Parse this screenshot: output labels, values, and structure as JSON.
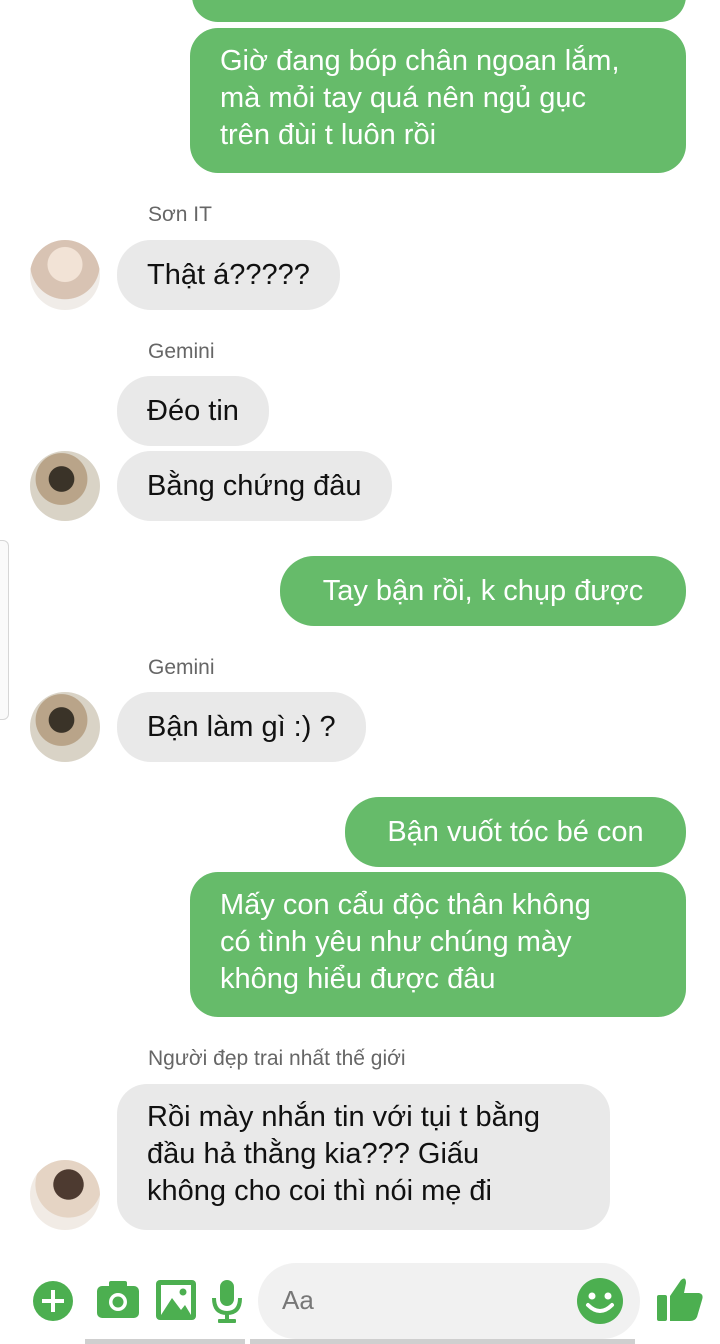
{
  "messages": {
    "m0": {
      "lines": [
        ""
      ]
    },
    "m1": {
      "lines": [
        "Giờ đang bóp chân ngoan lắm,",
        "mà mỏi tay quá nên ngủ gục",
        "trên đùi t luôn rồi"
      ]
    },
    "m2_sender": "Sơn IT",
    "m2": "Thật á?????",
    "m3_sender": "Gemini",
    "m3": "Đéo tin",
    "m4": "Bằng chứng đâu",
    "m5": "Tay bận rồi, k chụp được",
    "m6_sender": "Gemini",
    "m6": "Bận làm gì :) ?",
    "m7": "Bận vuốt tóc bé con",
    "m8": {
      "lines": [
        "Mấy con cẩu độc thân không",
        "có tình yêu như chúng mày",
        "không hiểu được đâu"
      ]
    },
    "m9_sender": "Người đẹp trai nhất thế giới",
    "m9": {
      "lines": [
        "Rồi mày nhắn tin với tụi t bằng",
        "đầu hả thằng kia??? Giấu",
        "không cho coi thì nói mẹ đi"
      ]
    }
  },
  "composer": {
    "placeholder": "Aa",
    "icons": [
      "plus-icon",
      "camera-icon",
      "image-icon",
      "microphone-icon",
      "emoji-icon",
      "thumbs-up-icon"
    ]
  },
  "colors": {
    "outgoing_bubble": "#66bb6a",
    "incoming_bubble": "#e9e9e9",
    "accent": "#4caf50"
  }
}
